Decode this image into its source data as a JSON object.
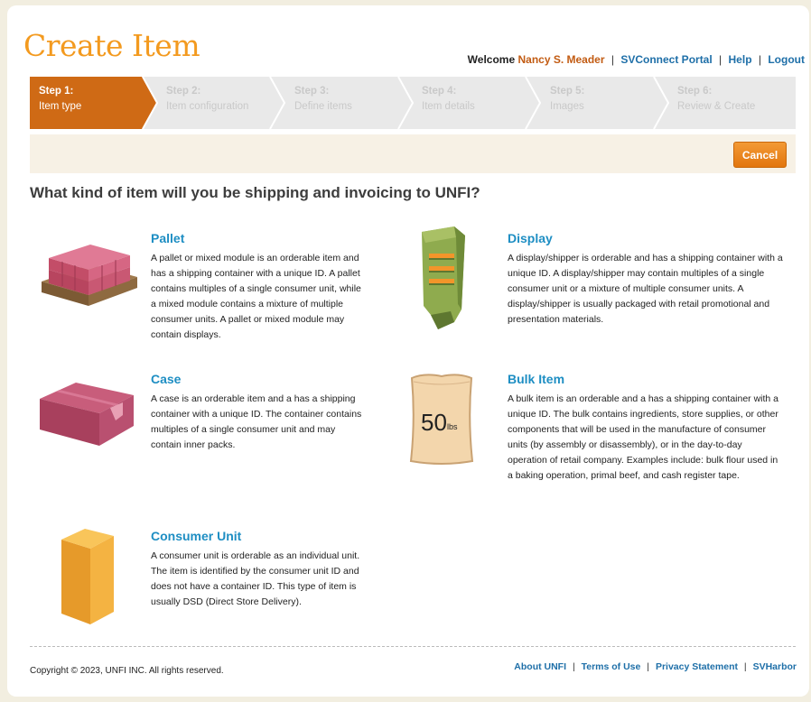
{
  "title": "Create Item",
  "header": {
    "welcome_label": "Welcome",
    "user_name": "Nancy S. Meader",
    "links": [
      "SVConnect Portal",
      "Help",
      "Logout"
    ]
  },
  "steps": [
    {
      "num": "Step 1:",
      "name": "Item type",
      "active": true
    },
    {
      "num": "Step 2:",
      "name": "Item configuration",
      "active": false
    },
    {
      "num": "Step 3:",
      "name": "Define items",
      "active": false
    },
    {
      "num": "Step 4:",
      "name": "Item details",
      "active": false
    },
    {
      "num": "Step 5:",
      "name": "Images",
      "active": false
    },
    {
      "num": "Step 6:",
      "name": "Review & Create",
      "active": false
    }
  ],
  "actions": {
    "cancel_label": "Cancel"
  },
  "question": "What kind of item will you be shipping and invoicing to UNFI?",
  "options": {
    "pallet": {
      "title": "Pallet",
      "description": "A pallet or mixed module is an orderable item and has a shipping container with a unique ID. A pallet contains multiples of a single consumer unit, while a mixed module contains a mixture of multiple consumer units. A pallet or mixed module may contain displays.",
      "icon": "pallet-icon"
    },
    "display": {
      "title": "Display",
      "description": "A display/shipper is orderable and has a shipping container with a unique ID. A display/shipper may contain multiples of a single consumer unit or a mixture of multiple consumer units. A display/shipper is usually packaged with retail promotional and presentation materials.",
      "icon": "display-icon"
    },
    "case": {
      "title": "Case",
      "description": "A case is an orderable item and a has a shipping container with a unique ID. The container contains multiples of a single consumer unit and may contain inner packs.",
      "icon": "case-icon"
    },
    "bulk": {
      "title": "Bulk Item",
      "description": "A bulk item is an orderable and a has a shipping container with a unique ID. The bulk contains ingredients, store supplies, or other components that will be used in the manufacture of consumer units (by assembly or disassembly), or in the day-to-day operation of retail company. Examples include: bulk flour used in a baking operation, primal beef, and cash register tape.",
      "icon": "bag-icon",
      "bag_number": "50",
      "bag_unit": "lbs"
    },
    "consumer": {
      "title": "Consumer Unit",
      "description": "A consumer unit is orderable as an individual unit. The item is identified by the consumer unit ID and does not have a container ID. This type of item is usually DSD (Direct Store Delivery).",
      "icon": "box-icon"
    }
  },
  "footer": {
    "copyright": "Copyright © 2023, UNFI INC. All rights reserved.",
    "links": [
      "About UNFI",
      "Terms of Use",
      "Privacy Statement",
      "SVHarbor"
    ]
  },
  "colors": {
    "accent_orange": "#f39a1f",
    "active_step": "#cf6a15",
    "link_blue": "#1e6fa8",
    "option_title_blue": "#1e8ec3"
  }
}
